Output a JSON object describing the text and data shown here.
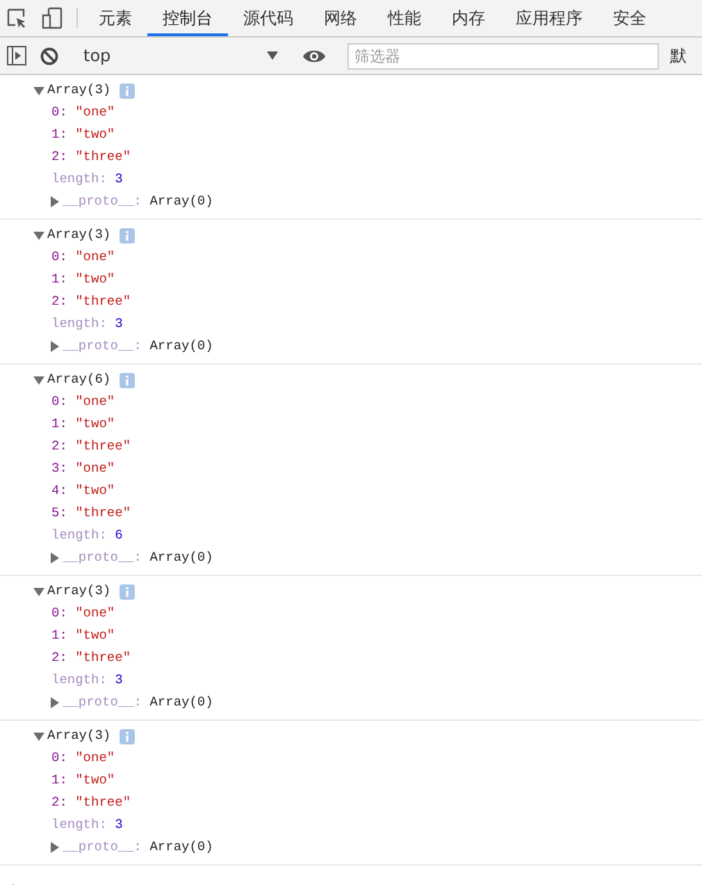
{
  "tabs": [
    {
      "label": "元素",
      "selected": false
    },
    {
      "label": "控制台",
      "selected": true
    },
    {
      "label": "源代码",
      "selected": false
    },
    {
      "label": "网络",
      "selected": false
    },
    {
      "label": "性能",
      "selected": false
    },
    {
      "label": "内存",
      "selected": false
    },
    {
      "label": "应用程序",
      "selected": false
    },
    {
      "label": "安全",
      "selected": false
    }
  ],
  "toolbar": {
    "context": "top",
    "filter": {
      "placeholder": "筛选器"
    },
    "levels": "默"
  },
  "entries": [
    {
      "summary": "Array(3)",
      "expanded": true,
      "items": [
        {
          "key": "0:",
          "value": "\"one\"",
          "kind": "string"
        },
        {
          "key": "1:",
          "value": "\"two\"",
          "kind": "string"
        },
        {
          "key": "2:",
          "value": "\"three\"",
          "kind": "string"
        },
        {
          "key": "length:",
          "value": "3",
          "kind": "number"
        }
      ],
      "proto": {
        "key": "__proto__:",
        "value": "Array(0)",
        "expanded": false
      }
    },
    {
      "summary": "Array(3)",
      "expanded": true,
      "items": [
        {
          "key": "0:",
          "value": "\"one\"",
          "kind": "string"
        },
        {
          "key": "1:",
          "value": "\"two\"",
          "kind": "string"
        },
        {
          "key": "2:",
          "value": "\"three\"",
          "kind": "string"
        },
        {
          "key": "length:",
          "value": "3",
          "kind": "number"
        }
      ],
      "proto": {
        "key": "__proto__:",
        "value": "Array(0)",
        "expanded": false
      }
    },
    {
      "summary": "Array(6)",
      "expanded": true,
      "items": [
        {
          "key": "0:",
          "value": "\"one\"",
          "kind": "string"
        },
        {
          "key": "1:",
          "value": "\"two\"",
          "kind": "string"
        },
        {
          "key": "2:",
          "value": "\"three\"",
          "kind": "string"
        },
        {
          "key": "3:",
          "value": "\"one\"",
          "kind": "string"
        },
        {
          "key": "4:",
          "value": "\"two\"",
          "kind": "string"
        },
        {
          "key": "5:",
          "value": "\"three\"",
          "kind": "string"
        },
        {
          "key": "length:",
          "value": "6",
          "kind": "number"
        }
      ],
      "proto": {
        "key": "__proto__:",
        "value": "Array(0)",
        "expanded": false
      }
    },
    {
      "summary": "Array(3)",
      "expanded": true,
      "items": [
        {
          "key": "0:",
          "value": "\"one\"",
          "kind": "string"
        },
        {
          "key": "1:",
          "value": "\"two\"",
          "kind": "string"
        },
        {
          "key": "2:",
          "value": "\"three\"",
          "kind": "string"
        },
        {
          "key": "length:",
          "value": "3",
          "kind": "number"
        }
      ],
      "proto": {
        "key": "__proto__:",
        "value": "Array(0)",
        "expanded": false
      }
    },
    {
      "summary": "Array(3)",
      "expanded": true,
      "items": [
        {
          "key": "0:",
          "value": "\"one\"",
          "kind": "string"
        },
        {
          "key": "1:",
          "value": "\"two\"",
          "kind": "string"
        },
        {
          "key": "2:",
          "value": "\"three\"",
          "kind": "string"
        },
        {
          "key": "length:",
          "value": "3",
          "kind": "number"
        }
      ],
      "proto": {
        "key": "__proto__:",
        "value": "Array(0)",
        "expanded": false
      }
    }
  ]
}
